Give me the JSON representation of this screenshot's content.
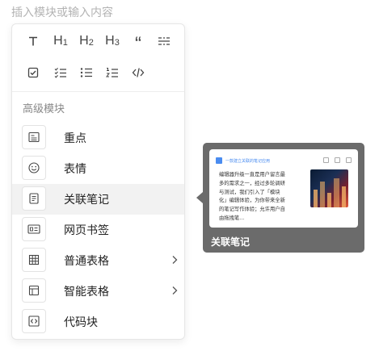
{
  "editor": {
    "placeholder": "插入模块或输入内容"
  },
  "toolbar": {
    "row1": [
      "text-format-icon",
      "heading-1-icon",
      "heading-2-icon",
      "heading-3-icon",
      "quote-icon",
      "divider-line-icon"
    ],
    "row2": [
      "checkbox-icon",
      "checklist-icon",
      "bullet-list-icon",
      "numbered-list-icon",
      "code-icon"
    ],
    "h1": "H",
    "h1_sub": "1",
    "h2": "H",
    "h2_sub": "2",
    "h3": "H",
    "h3_sub": "3",
    "quote": "“"
  },
  "section": {
    "title": "高级模块"
  },
  "items": [
    {
      "label": "重点",
      "icon": "highlight-block-icon",
      "has_submenu": false
    },
    {
      "label": "表情",
      "icon": "smiley-icon",
      "has_submenu": false
    },
    {
      "label": "关联笔记",
      "icon": "linked-note-icon",
      "has_submenu": false,
      "active": true
    },
    {
      "label": "网页书签",
      "icon": "web-bookmark-icon",
      "has_submenu": false
    },
    {
      "label": "普通表格",
      "icon": "table-icon",
      "has_submenu": true
    },
    {
      "label": "智能表格",
      "icon": "smart-table-icon",
      "has_submenu": true
    },
    {
      "label": "代码块",
      "icon": "code-block-icon",
      "has_submenu": false
    }
  ],
  "preview": {
    "label": "关联笔记",
    "card": {
      "title": "一款建立关联的笔记应用",
      "body": "编辑器升级一直是用户留言最多的需求之一，经过多轮调研与测试，我们引入了「模块化」编辑体验，为你带来全新的笔记写作体验；允许用户自由拖拽笔...",
      "image": "city-night-photo"
    },
    "colors": {
      "panel_bg": "#6b6b6b",
      "link_blue": "#4a8cf0"
    }
  }
}
